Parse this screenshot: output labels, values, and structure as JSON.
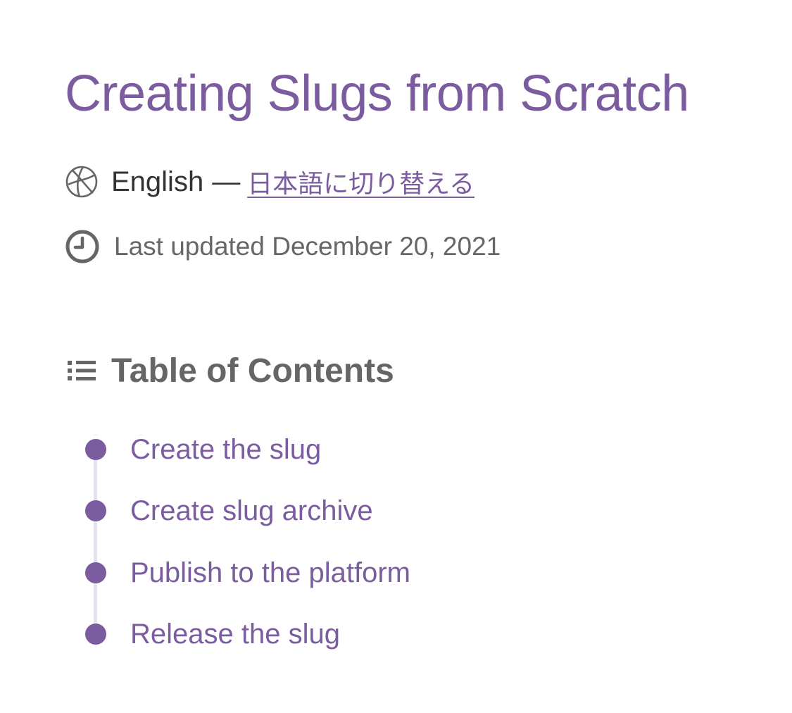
{
  "title": "Creating Slugs from Scratch",
  "language": {
    "icon": "globe-icon",
    "current": "English",
    "separator": "—",
    "switch_link": "日本語に切り替える"
  },
  "updated": {
    "icon": "clock-icon",
    "text": "Last updated December 20, 2021"
  },
  "toc": {
    "icon": "list-icon",
    "heading": "Table of Contents",
    "items": [
      {
        "label": "Create the slug"
      },
      {
        "label": "Create slug archive"
      },
      {
        "label": "Publish to the platform"
      },
      {
        "label": "Release the slug"
      }
    ]
  },
  "colors": {
    "accent": "#7a5c9f",
    "text": "#333333",
    "muted": "#666666",
    "timeline": "#e6e1ee"
  }
}
